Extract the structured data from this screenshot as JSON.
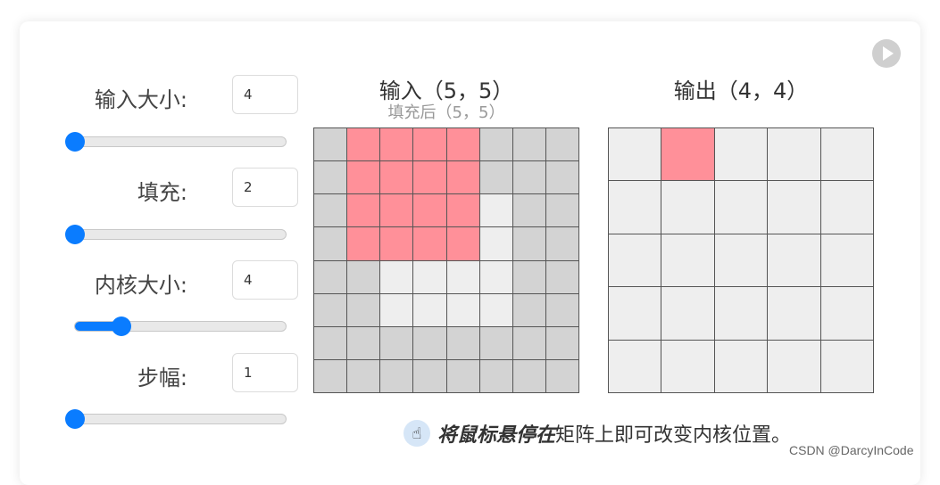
{
  "controls": {
    "input_size": {
      "label": "输入大小:",
      "value": "4",
      "slider": 0.0
    },
    "padding": {
      "label": "填充:",
      "value": "2",
      "slider": 0.0
    },
    "kernel_size": {
      "label": "内核大小:",
      "value": "4",
      "slider": 0.22
    },
    "stride": {
      "label": "步幅:",
      "value": "1",
      "slider": 0.0
    }
  },
  "input_matrix": {
    "title": "输入（5，5）",
    "subtitle": "填充后（5，5）",
    "size": 8,
    "light_cells": [
      [
        2,
        5
      ],
      [
        3,
        5
      ],
      [
        4,
        2
      ],
      [
        4,
        3
      ],
      [
        4,
        4
      ],
      [
        4,
        5
      ],
      [
        5,
        2
      ],
      [
        5,
        3
      ],
      [
        5,
        4
      ],
      [
        5,
        5
      ]
    ],
    "kernel_cells": [
      [
        0,
        1
      ],
      [
        0,
        2
      ],
      [
        0,
        3
      ],
      [
        0,
        4
      ],
      [
        1,
        1
      ],
      [
        1,
        2
      ],
      [
        1,
        3
      ],
      [
        1,
        4
      ],
      [
        2,
        1
      ],
      [
        2,
        2
      ],
      [
        2,
        3
      ],
      [
        2,
        4
      ],
      [
        3,
        1
      ],
      [
        3,
        2
      ],
      [
        3,
        3
      ],
      [
        3,
        4
      ]
    ]
  },
  "output_matrix": {
    "title": "输出（4，4）",
    "size": 5,
    "kernel_cells": [
      [
        0,
        1
      ]
    ]
  },
  "hint": {
    "bold": "将鼠标悬停在",
    "rest": "矩阵上即可改变内核位置。",
    "icon": "pointer-hand-icon"
  },
  "watermark": "CSDN @DarcyInCode",
  "colors": {
    "accent": "#0a7cff",
    "kernel": "#ff9099",
    "pad": "#d3d3d3",
    "active": "#eeeeee"
  }
}
